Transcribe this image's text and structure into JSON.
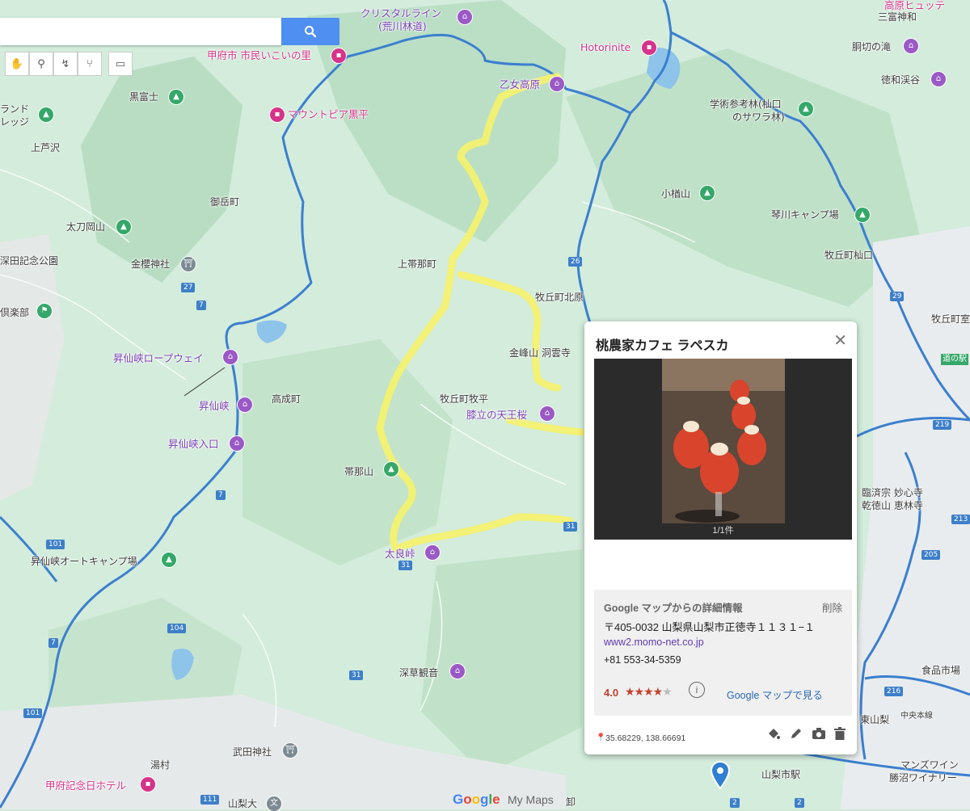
{
  "search": {
    "placeholder": ""
  },
  "toolbar": {
    "tools": [
      "hand-icon",
      "marker-icon",
      "line-icon",
      "route-icon",
      "ruler-icon"
    ]
  },
  "map": {
    "labels": {
      "crystal_line": "クリスタルライン",
      "crystal_line_sub": "(荒川林道)",
      "hotorinite": "Hotorinite",
      "kofu_shimin": "甲府市 市民いこいの里",
      "mount_pia": "マウントピア黒平",
      "kurofuji": "黒富士",
      "land": "ランド",
      "lage": "レッジ",
      "kamiashizawa": "上芦沢",
      "mitake_cho": "御岳町",
      "tachioka_yama": "太刀岡山",
      "kinzakura": "金櫻神社",
      "fukada_kinen": "深田記念公園",
      "kurabu": "倶楽部",
      "shosenkyo_ropeway": "昇仙峡ロープウェイ",
      "shosenkyo": "昇仙峡",
      "shosenkyo_iriguchi": "昇仙峡入口",
      "takanari_cho": "高成町",
      "kamitabana_cho": "上帯那町",
      "otome_kogen": "乙女高原",
      "makioka_kitahara": "牧丘町北原",
      "kinpusan_touunji": "金峰山 洞雲寺",
      "makioka_makidaira": "牧丘町牧平",
      "hizatachi": "膝立の天王桜",
      "obinayama": "帯那山",
      "tarato": "太良峠",
      "koguramayama": "小楢山",
      "kotokawa_camp": "琴川キャンプ場",
      "gakujutsu": "学術参考林(杣口",
      "gakujutsu_sub": "のサワラ林)",
      "makioka_somaguchi": "牧丘町杣口",
      "makioka_muro": "牧丘町室",
      "michinoeki": "道の駅",
      "mitomi_kamikawa": "三富神和",
      "douki_taki": "胴切の滝",
      "tokuwa": "徳和渓谷",
      "kogen_hutte": "高原ヒュッテ",
      "shosenkyo_camp": "昇仙峡オートキャンプ場",
      "fukakusa": "深草観音",
      "takeda_jinja": "武田神社",
      "yumura": "湯村",
      "kofu_hotel": "甲府記念日ホテル",
      "yamanashi_dai": "山梨大",
      "rinzaishu": "臨済宗 妙心寺",
      "kenshin": "乾徳山 恵林寺",
      "shokuhin": "食品市場",
      "higashiyamanashi": "東山梨",
      "chuo": "中央本線",
      "manns": "マンズワイン",
      "katsunuma": "勝沼ワイナリー",
      "yamanashi_city": "山梨市駅",
      "kyu": "卸"
    },
    "shields": [
      "27",
      "7",
      "7",
      "101",
      "104",
      "7",
      "101",
      "26",
      "29",
      "219",
      "213",
      "205",
      "216",
      "31",
      "31",
      "31",
      "111",
      "2",
      "2"
    ]
  },
  "card": {
    "title": "桃農家カフェ ラペスカ",
    "photo_counter": "1/1件",
    "details_heading": "Google マップからの詳細情報",
    "delete_label": "削除",
    "address": "〒405-0032 山梨県山梨市正徳寺１１３１−１",
    "url": "www2.momo-net.co.jp",
    "phone": "+81 553-34-5359",
    "rating": "4.0",
    "stars_full": "★★★★",
    "stars_empty": "★",
    "info_symbol": "i",
    "gmaps_link": "Google マップで見る",
    "coordinates": "35.68229, 138.66691",
    "actions": [
      "paint-bucket-icon",
      "pencil-icon",
      "camera-icon",
      "trash-icon"
    ]
  },
  "branding": {
    "google": "Google",
    "mymaps": "My Maps"
  },
  "colors": {
    "route_yellow": "#f6f26a",
    "road_blue": "#3b7fcf",
    "accent_blue": "#4f8ff2"
  }
}
